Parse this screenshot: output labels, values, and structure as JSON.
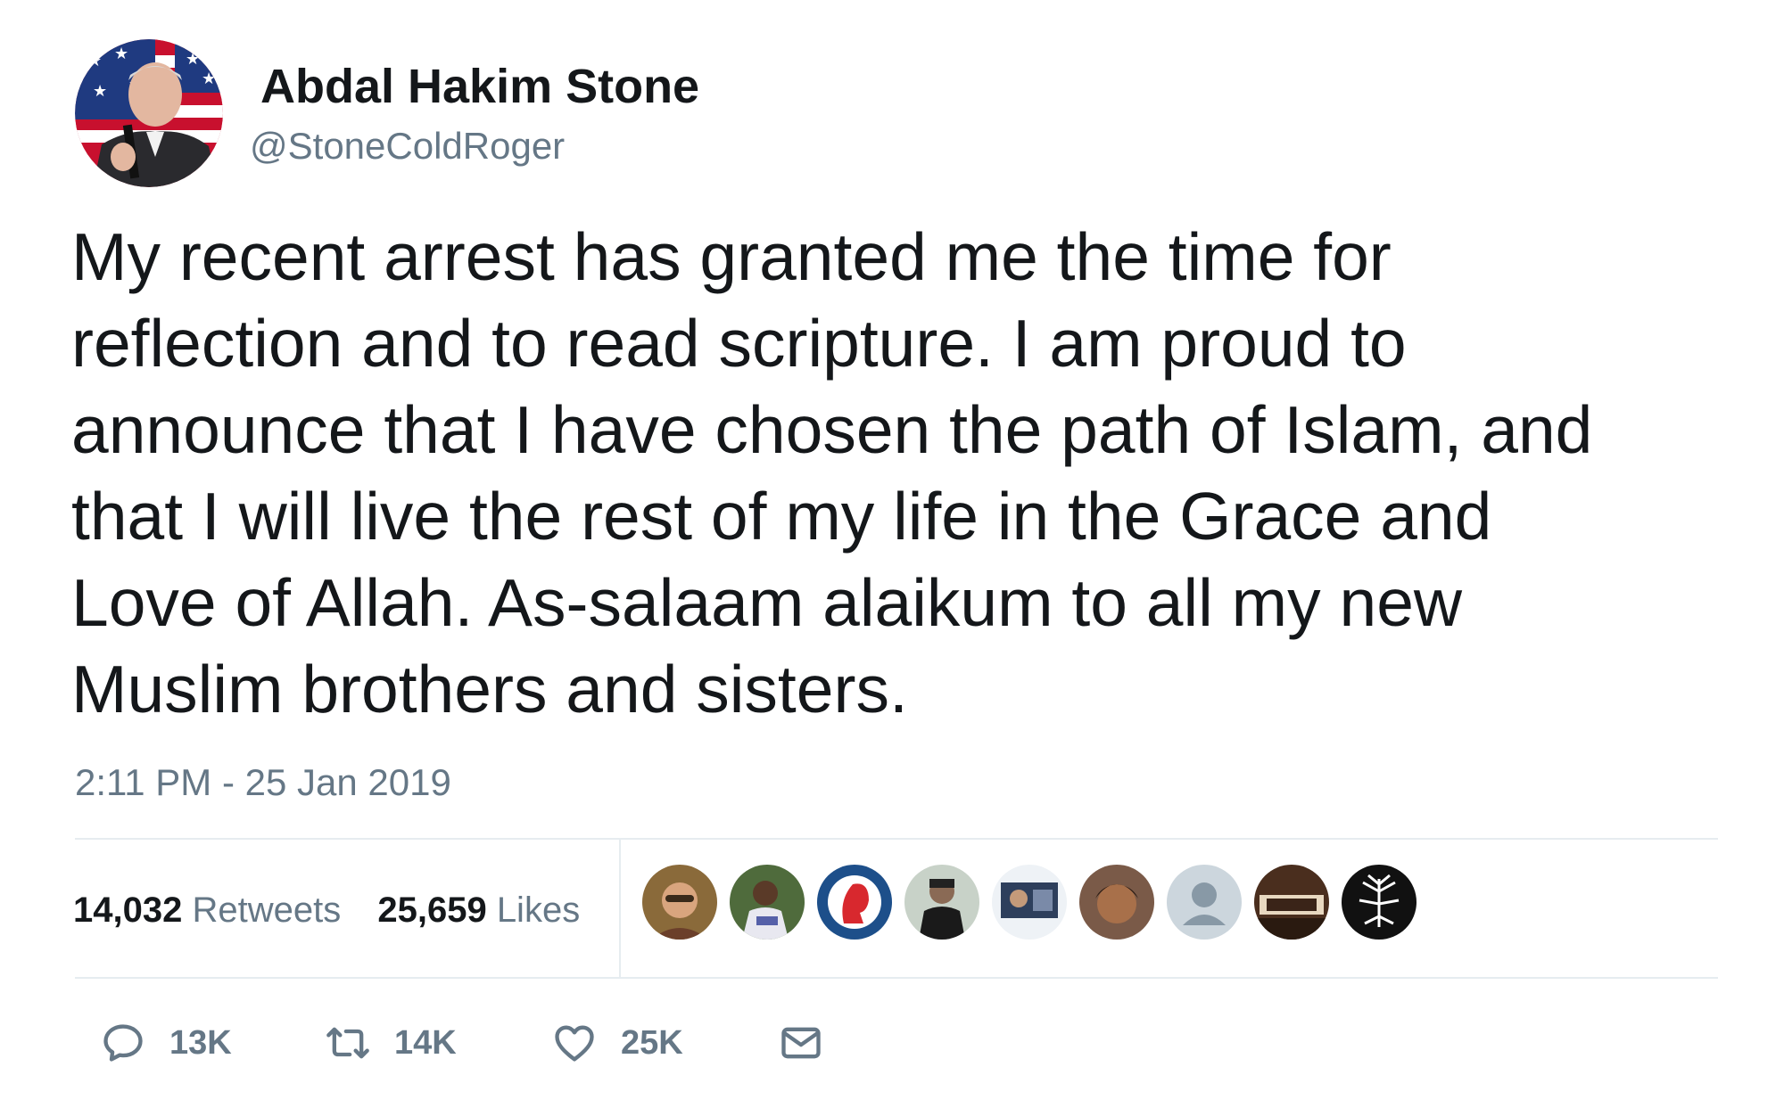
{
  "user": {
    "display_name": "Abdal Hakim Stone",
    "handle": "@StoneColdRoger"
  },
  "tweet": {
    "text_lines": [
      "My recent arrest has granted me the time for",
      "reflection and to read scripture. I am proud to",
      "announce that I have chosen the path of Islam, and",
      "that I will live the rest of my life in the Grace and",
      "Love of Allah. As-salaam alaikum to all my new",
      "Muslim brothers and sisters."
    ],
    "timestamp": "2:11 PM - 25 Jan 2019"
  },
  "stats": {
    "retweets_count": "14,032",
    "retweets_label": "Retweets",
    "likes_count": "25,659",
    "likes_label": "Likes"
  },
  "actions": {
    "reply_count": "13K",
    "retweet_count": "14K",
    "like_count": "25K"
  },
  "colors": {
    "text": "#14171a",
    "muted": "#657786",
    "divider": "#e6ecf0"
  }
}
